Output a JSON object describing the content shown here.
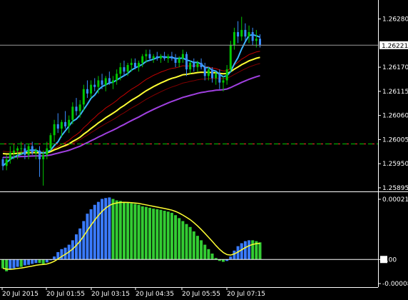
{
  "colors": {
    "background": "#000000",
    "axis": "#ffffff",
    "bull_candle": "#00c800",
    "bear_candle": "#3a8cff",
    "ma_fast": "#3ab4ff",
    "ma_yellow": "#ffff33",
    "ma_purple": "#a040e0",
    "ma_red": "#c00000",
    "ma_darkred": "#800000",
    "hist_blue": "#3a7bff",
    "hist_green": "#33cc33",
    "signal": "#ffff33",
    "current_price_line": "#a0a0a0",
    "dash_line_a": "#00c800",
    "dash_line_b": "#ff3030"
  },
  "price_axis": {
    "labels": [
      "1.26280",
      "1.26170",
      "1.26115",
      "1.26060",
      "1.26005",
      "1.25950",
      "1.25895"
    ],
    "current_price": "1.26221",
    "current_price_value": 1.26221,
    "range": [
      1.2589,
      1.2632
    ],
    "dashed_level": 1.25995
  },
  "indicator_axis": {
    "top_label": "0.000211",
    "zero_label": "0.00",
    "bottom_label": "-0.000084",
    "range": [
      -8.4e-05,
      0.000211
    ]
  },
  "time_axis": {
    "labels": [
      "20 Jul 2015",
      "20 Jul 01:55",
      "20 Jul 03:15",
      "20 Jul 04:35",
      "20 Jul 05:55",
      "20 Jul 07:15"
    ]
  },
  "chart_data": {
    "type": "candlestick",
    "candles": [
      [
        1.2596,
        1.25965,
        1.25935,
        1.25945
      ],
      [
        1.25945,
        1.2597,
        1.25935,
        1.2596
      ],
      [
        1.2596,
        1.2599,
        1.2595,
        1.25975
      ],
      [
        1.25975,
        1.25995,
        1.2596,
        1.2598
      ],
      [
        1.2598,
        1.2599,
        1.2596,
        1.25985
      ],
      [
        1.25985,
        1.26,
        1.2597,
        1.25985
      ],
      [
        1.25985,
        1.25995,
        1.2596,
        1.2597
      ],
      [
        1.2597,
        1.25995,
        1.2596,
        1.2599
      ],
      [
        1.2599,
        1.26,
        1.2597,
        1.25975
      ],
      [
        1.25975,
        1.25985,
        1.2596,
        1.2598
      ],
      [
        1.2598,
        1.2599,
        1.2592,
        1.2596
      ],
      [
        1.2596,
        1.2598,
        1.259,
        1.2597
      ],
      [
        1.2597,
        1.26,
        1.2596,
        1.25985
      ],
      [
        1.25985,
        1.2602,
        1.2598,
        1.26015
      ],
      [
        1.26015,
        1.2605,
        1.26,
        1.2604
      ],
      [
        1.2604,
        1.26065,
        1.2602,
        1.2603
      ],
      [
        1.2603,
        1.2605,
        1.2601,
        1.26045
      ],
      [
        1.26045,
        1.2607,
        1.2603,
        1.26035
      ],
      [
        1.26035,
        1.2606,
        1.2602,
        1.2605
      ],
      [
        1.2605,
        1.2609,
        1.2604,
        1.2608
      ],
      [
        1.2608,
        1.261,
        1.2606,
        1.2607
      ],
      [
        1.2607,
        1.26095,
        1.26055,
        1.26085
      ],
      [
        1.26085,
        1.2613,
        1.2607,
        1.2612
      ],
      [
        1.2612,
        1.2614,
        1.261,
        1.2611
      ],
      [
        1.2611,
        1.2614,
        1.261,
        1.2613
      ],
      [
        1.2613,
        1.26145,
        1.26115,
        1.26125
      ],
      [
        1.26125,
        1.2615,
        1.2611,
        1.2614
      ],
      [
        1.2614,
        1.26155,
        1.2612,
        1.2613
      ],
      [
        1.2613,
        1.2615,
        1.26115,
        1.26145
      ],
      [
        1.26145,
        1.2616,
        1.2613,
        1.26135
      ],
      [
        1.26135,
        1.2615,
        1.2612,
        1.2614
      ],
      [
        1.2614,
        1.26165,
        1.2613,
        1.26155
      ],
      [
        1.26155,
        1.2618,
        1.2614,
        1.2617
      ],
      [
        1.2617,
        1.26185,
        1.2615,
        1.2616
      ],
      [
        1.2616,
        1.2618,
        1.2615,
        1.26175
      ],
      [
        1.26175,
        1.2619,
        1.2616,
        1.2618
      ],
      [
        1.2618,
        1.2619,
        1.26165,
        1.2617
      ],
      [
        1.2617,
        1.26185,
        1.2616,
        1.2618
      ],
      [
        1.2618,
        1.262,
        1.2617,
        1.26195
      ],
      [
        1.26195,
        1.2621,
        1.2618,
        1.262
      ],
      [
        1.262,
        1.2621,
        1.26185,
        1.2619
      ],
      [
        1.2619,
        1.262,
        1.2618,
        1.26195
      ],
      [
        1.26195,
        1.26205,
        1.26185,
        1.2619
      ],
      [
        1.2619,
        1.262,
        1.2618,
        1.26195
      ],
      [
        1.26195,
        1.26205,
        1.26185,
        1.2619
      ],
      [
        1.2619,
        1.262,
        1.2618,
        1.26195
      ],
      [
        1.26195,
        1.26205,
        1.26185,
        1.2619
      ],
      [
        1.2619,
        1.262,
        1.2617,
        1.2618
      ],
      [
        1.2618,
        1.26195,
        1.2617,
        1.2619
      ],
      [
        1.2619,
        1.2621,
        1.2618,
        1.262
      ],
      [
        1.262,
        1.26205,
        1.2615,
        1.26165
      ],
      [
        1.26165,
        1.26185,
        1.26155,
        1.2618
      ],
      [
        1.2618,
        1.2619,
        1.2616,
        1.2617
      ],
      [
        1.2617,
        1.26185,
        1.2616,
        1.2618
      ],
      [
        1.2618,
        1.2619,
        1.26165,
        1.2617
      ],
      [
        1.2617,
        1.2618,
        1.2614,
        1.2615
      ],
      [
        1.2615,
        1.2617,
        1.2614,
        1.26165
      ],
      [
        1.26165,
        1.2617,
        1.26135,
        1.26145
      ],
      [
        1.26145,
        1.2616,
        1.2613,
        1.26155
      ],
      [
        1.26155,
        1.26165,
        1.2612,
        1.26135
      ],
      [
        1.26135,
        1.2615,
        1.26115,
        1.2614
      ],
      [
        1.2614,
        1.26175,
        1.2613,
        1.26165
      ],
      [
        1.26165,
        1.2623,
        1.2616,
        1.2622
      ],
      [
        1.2622,
        1.2626,
        1.2621,
        1.2625
      ],
      [
        1.2625,
        1.26275,
        1.26225,
        1.2624
      ],
      [
        1.2624,
        1.26285,
        1.2623,
        1.26255
      ],
      [
        1.26255,
        1.2627,
        1.2623,
        1.2624
      ],
      [
        1.2624,
        1.26265,
        1.26225,
        1.2625
      ],
      [
        1.2625,
        1.2626,
        1.2622,
        1.2623
      ],
      [
        1.2623,
        1.26255,
        1.26215,
        1.26235
      ],
      [
        1.26235,
        1.26245,
        1.26215,
        1.26221
      ]
    ],
    "indicator": {
      "histogram": [
        -3e-05,
        -4e-05,
        -3.5e-05,
        -3e-05,
        -2.5e-05,
        -2.5e-05,
        -2e-05,
        -1.8e-05,
        -1.5e-05,
        -1.2e-05,
        -1.2e-05,
        -1.5e-05,
        -1e-05,
        0.0,
        1e-05,
        2.5e-05,
        3.5e-05,
        4e-05,
        5e-05,
        6.5e-05,
        8.5e-05,
        0.000105,
        0.00013,
        0.000155,
        0.00017,
        0.000185,
        0.000195,
        0.000205,
        0.000208,
        0.00021,
        0.000205,
        0.0002,
        0.000198,
        0.000195,
        0.000192,
        0.00019,
        0.000188,
        0.000185,
        0.00018,
        0.000178,
        0.000175,
        0.000172,
        0.00017,
        0.000168,
        0.000165,
        0.000162,
        0.000158,
        0.00015,
        0.00014,
        0.00013,
        0.00012,
        0.00011,
        9.5e-05,
        8e-05,
        6.5e-05,
        5e-05,
        3.5e-05,
        2e-05,
        5e-06,
        -5e-06,
        -8e-06,
        -5e-06,
        1e-05,
        3e-05,
        4.5e-05,
        5.5e-05,
        6.2e-05,
        6.5e-05,
        6.5e-05,
        6.2e-05,
        5.8e-05
      ],
      "rising": [
        false,
        false,
        true,
        true,
        true,
        false,
        true,
        true,
        true,
        true,
        false,
        false,
        true,
        true,
        true,
        true,
        true,
        true,
        true,
        true,
        true,
        true,
        true,
        true,
        true,
        true,
        true,
        true,
        true,
        true,
        false,
        false,
        false,
        false,
        false,
        false,
        false,
        false,
        false,
        false,
        false,
        false,
        false,
        false,
        false,
        false,
        false,
        false,
        false,
        false,
        false,
        false,
        false,
        false,
        false,
        false,
        false,
        false,
        false,
        false,
        false,
        true,
        true,
        true,
        true,
        true,
        true,
        true,
        false,
        false,
        false
      ]
    }
  }
}
